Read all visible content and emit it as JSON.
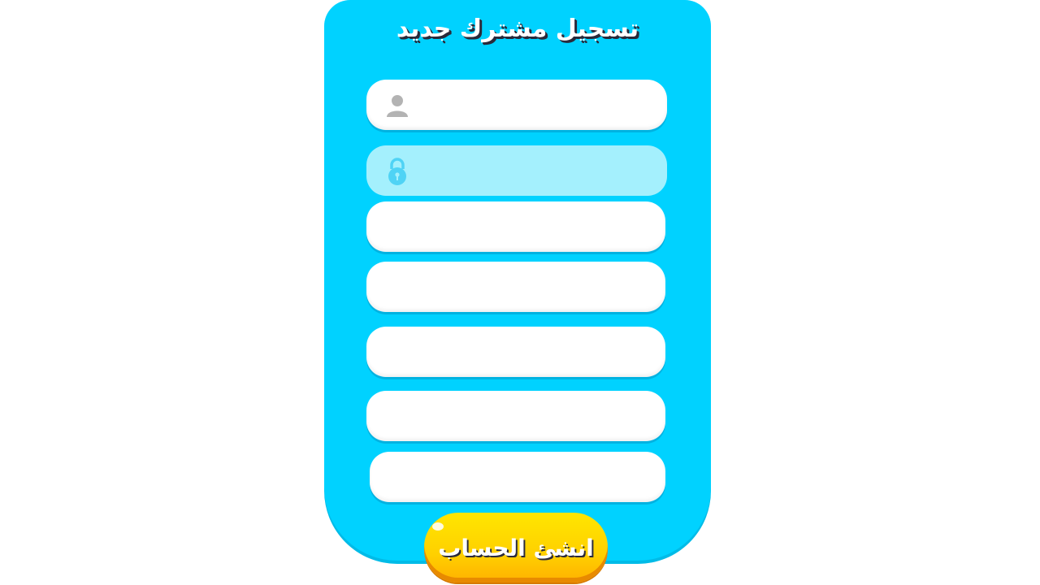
{
  "header": {
    "title": "تسجيل مشترك جديد"
  },
  "form": {
    "username_value": "",
    "password_value": "",
    "field3_value": "",
    "field4_value": "",
    "field5_value": "",
    "field6_value": "",
    "field7_value": "",
    "icons": {
      "username": "user-icon",
      "password": "lock-icon"
    }
  },
  "actions": {
    "create_account_label": "انشئ الحساب"
  },
  "colors": {
    "panel": "#00d2ff",
    "field": "#ffffff",
    "active_field": "#a4f0fd",
    "button": "#ffd000",
    "icon_gray": "#b3b3b3",
    "icon_lock": "#4fd3f5"
  }
}
